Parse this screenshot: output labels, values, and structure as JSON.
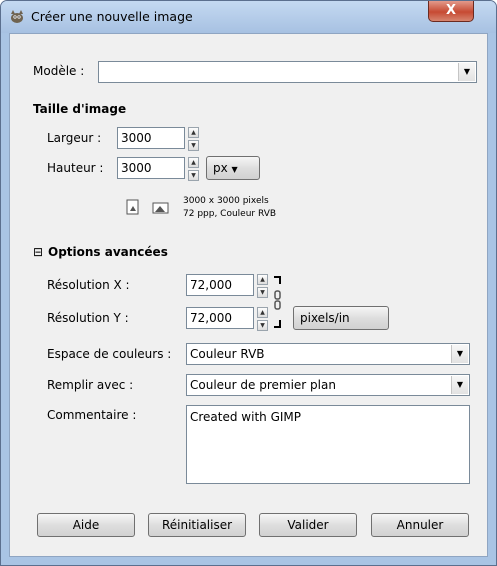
{
  "window": {
    "title": "Créer une nouvelle image",
    "close_label": "X"
  },
  "template": {
    "label": "Modèle :",
    "value": ""
  },
  "image_size": {
    "heading": "Taille d'image",
    "width_label": "Largeur :",
    "width_value": "3000",
    "height_label": "Hauteur :",
    "height_value": "3000",
    "unit": "px",
    "info_line1": "3000 x 3000 pixels",
    "info_line2": "72 ppp, Couleur RVB"
  },
  "advanced": {
    "toggle": "⊟",
    "heading": "Options avancées",
    "res_x_label": "Résolution X :",
    "res_x_value": "72,000",
    "res_y_label": "Résolution Y :",
    "res_y_value": "72,000",
    "res_unit": "pixels/in",
    "colorspace_label": "Espace de couleurs :",
    "colorspace_value": "Couleur RVB",
    "fill_label": "Remplir avec :",
    "fill_value": "Couleur de premier plan",
    "comment_label": "Commentaire :",
    "comment_value": "Created with GIMP"
  },
  "buttons": {
    "help": "Aide",
    "reset": "Réinitialiser",
    "ok": "Valider",
    "cancel": "Annuler"
  },
  "icons": {
    "app": "gimp-wilber-icon",
    "portrait": "portrait-icon",
    "landscape": "landscape-icon",
    "chain": "chain-link-icon"
  }
}
